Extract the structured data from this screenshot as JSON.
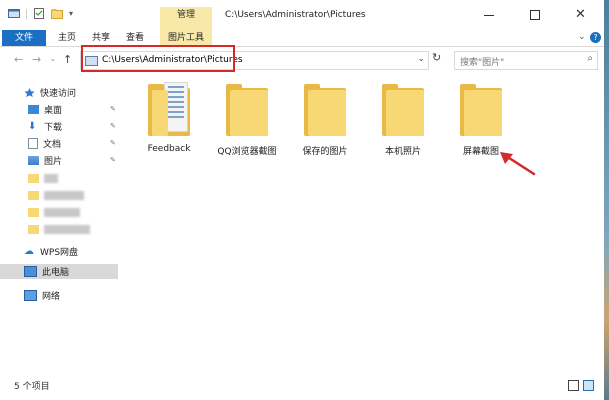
{
  "title": {
    "path": "C:\\Users\\Administrator\\Pictures",
    "context_group": "管理"
  },
  "ribbon": {
    "tabs": [
      {
        "label": "文件"
      },
      {
        "label": "主页"
      },
      {
        "label": "共享"
      },
      {
        "label": "查看"
      },
      {
        "label": "图片工具"
      }
    ]
  },
  "address": {
    "path": "C:\\Users\\Administrator\\Pictures",
    "search_placeholder": "搜索\"图片\""
  },
  "sidebar": {
    "quick_access": "快速访问",
    "pinned": [
      {
        "label": "桌面"
      },
      {
        "label": "下载"
      },
      {
        "label": "文档"
      },
      {
        "label": "图片"
      }
    ],
    "wps": "WPS网盘",
    "this_pc": "此电脑",
    "network": "网络"
  },
  "folders": [
    {
      "name": "Feedback"
    },
    {
      "name": "QQ浏览器截图"
    },
    {
      "name": "保存的图片"
    },
    {
      "name": "本机照片"
    },
    {
      "name": "屏幕截图"
    }
  ],
  "status": {
    "count_text": "5 个项目"
  },
  "colors": {
    "accent": "#1a6fc2",
    "folder": "#f8d775",
    "context_tab": "#f8e9a8",
    "highlight": "#d42a2a"
  }
}
